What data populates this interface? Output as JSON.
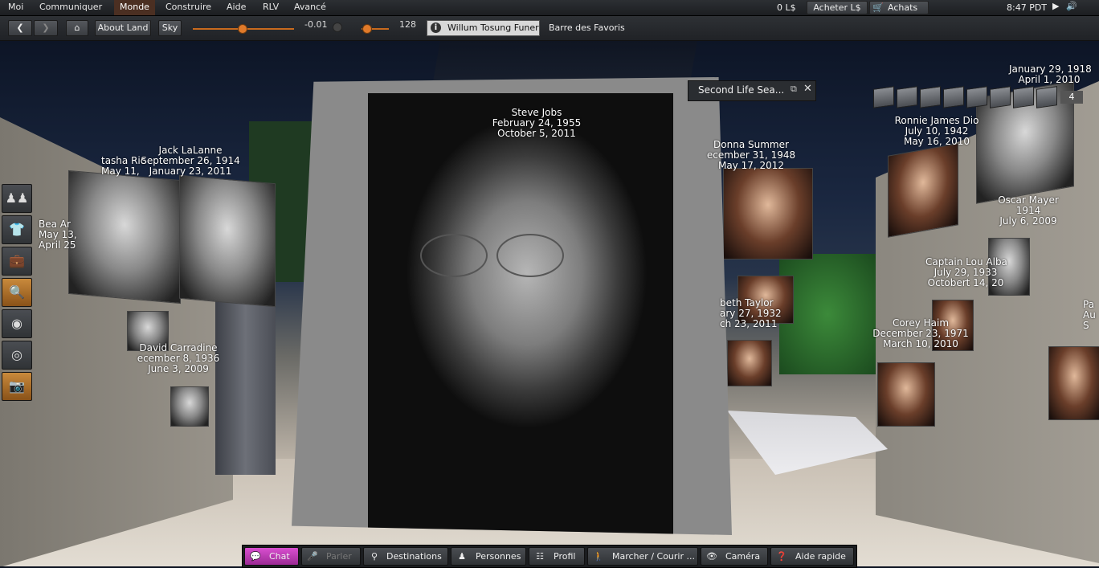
{
  "menu": {
    "items": [
      "Moi",
      "Communiquer",
      "Monde",
      "Construire",
      "Aide",
      "RLV",
      "Avancé"
    ],
    "balance": "0 L$",
    "buy_label": "Acheter L$",
    "shop_label": "Achats",
    "time": "8:47 PDT"
  },
  "navbar": {
    "about_land": "About Land",
    "sky": "Sky",
    "slider1_value": "-0.01",
    "slider2_value": "128",
    "location": "Willum Tosung Funeral",
    "favorites": "Barre des Favoris"
  },
  "floater": {
    "title": "Second Life Sea..."
  },
  "camera_count": "4",
  "memorials": [
    {
      "name": "Steve Jobs",
      "born": "February 24, 1955",
      "died": "October 5, 2011"
    },
    {
      "name": "Jack LaLanne",
      "born": "September 26, 1914",
      "died": "January 23, 2011"
    },
    {
      "name": "tasha Ric",
      "born": "May 11,",
      "died": ""
    },
    {
      "name": "Bea Ar",
      "born": "May 13,",
      "died": "April 25"
    },
    {
      "name": "David Carradine",
      "born": "ecember 8, 1936",
      "died": "June 3, 2009"
    },
    {
      "name": "Donna Summer",
      "born": "ecember 31, 1948",
      "died": "May 17, 2012"
    },
    {
      "name": "beth Taylor",
      "born": "ary 27, 1932",
      "died": "ch 23, 2011"
    },
    {
      "name": "Ronnie James Dio",
      "born": "July 10, 1942",
      "died": "May 16, 2010"
    },
    {
      "name": "",
      "born": "January 29, 1918",
      "died": "April 1, 2010"
    },
    {
      "name": "Oscar Mayer",
      "born": "1914",
      "died": "July 6, 2009"
    },
    {
      "name": "Captain Lou Alba",
      "born": "July 29, 1933",
      "died": "Octobert 14, 20"
    },
    {
      "name": "Corey Haim",
      "born": "December 23, 1971",
      "died": "March 10, 2010"
    },
    {
      "name": "Pa",
      "born": "Au",
      "died": "S"
    }
  ],
  "sidebar": [
    "people-icon",
    "appearance-icon",
    "inventory-icon",
    "search-icon",
    "places-icon",
    "radar-icon",
    "snapshot-icon"
  ],
  "toolbar": {
    "chat": "Chat",
    "speak": "Parler",
    "destinations": "Destinations",
    "people": "Personnes",
    "profile": "Profil",
    "walk": "Marcher / Courir ...",
    "camera": "Caméra",
    "help": "Aide rapide"
  }
}
